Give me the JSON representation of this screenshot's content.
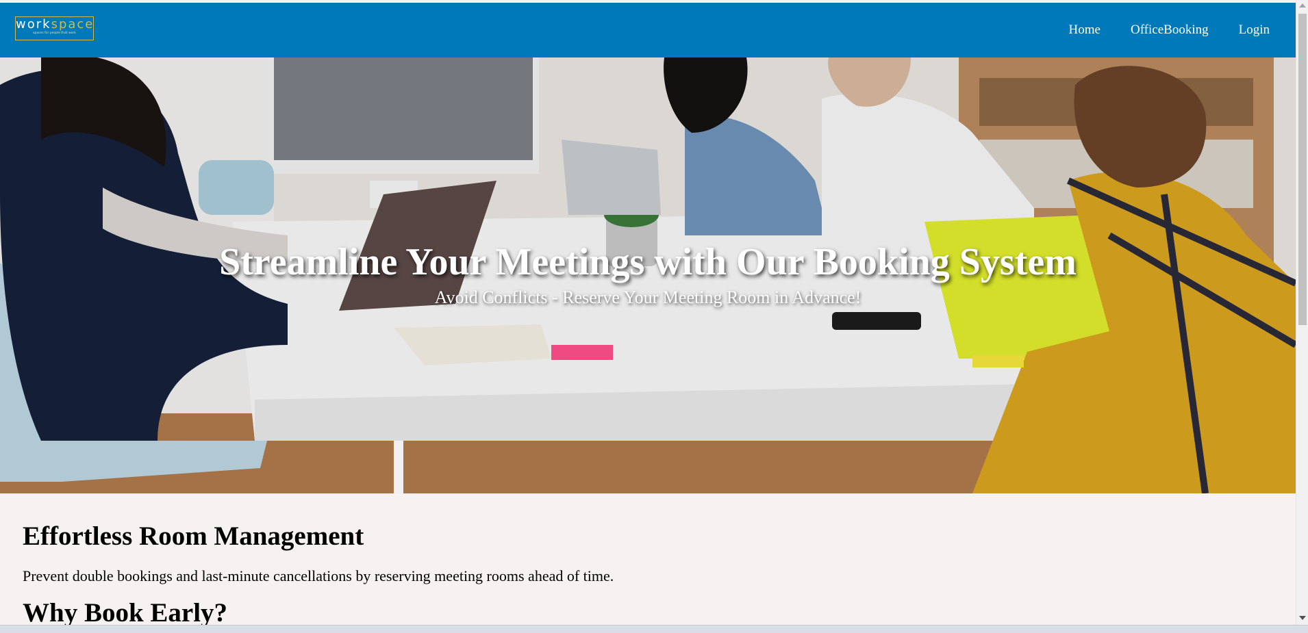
{
  "logo": {
    "word_part1": "work",
    "word_part2": "space",
    "tagline": "spaces for people that work"
  },
  "nav": {
    "items": [
      {
        "label": "Home"
      },
      {
        "label": "OfficeBooking"
      },
      {
        "label": "Login"
      }
    ]
  },
  "hero": {
    "title": "Streamline Your Meetings with Our Booking System",
    "subtitle": "Avoid Conflicts - Reserve Your Meeting Room in Advance!"
  },
  "content": {
    "heading": "Effortless Room Management",
    "paragraph": "Prevent double bookings and last-minute cancellations by reserving meeting rooms ahead of time.",
    "heading2": "Why Book Early?"
  },
  "colors": {
    "navbar": "#0079ba",
    "logo_accent": "#d3b84e",
    "page_background": "#f6f2f2"
  }
}
